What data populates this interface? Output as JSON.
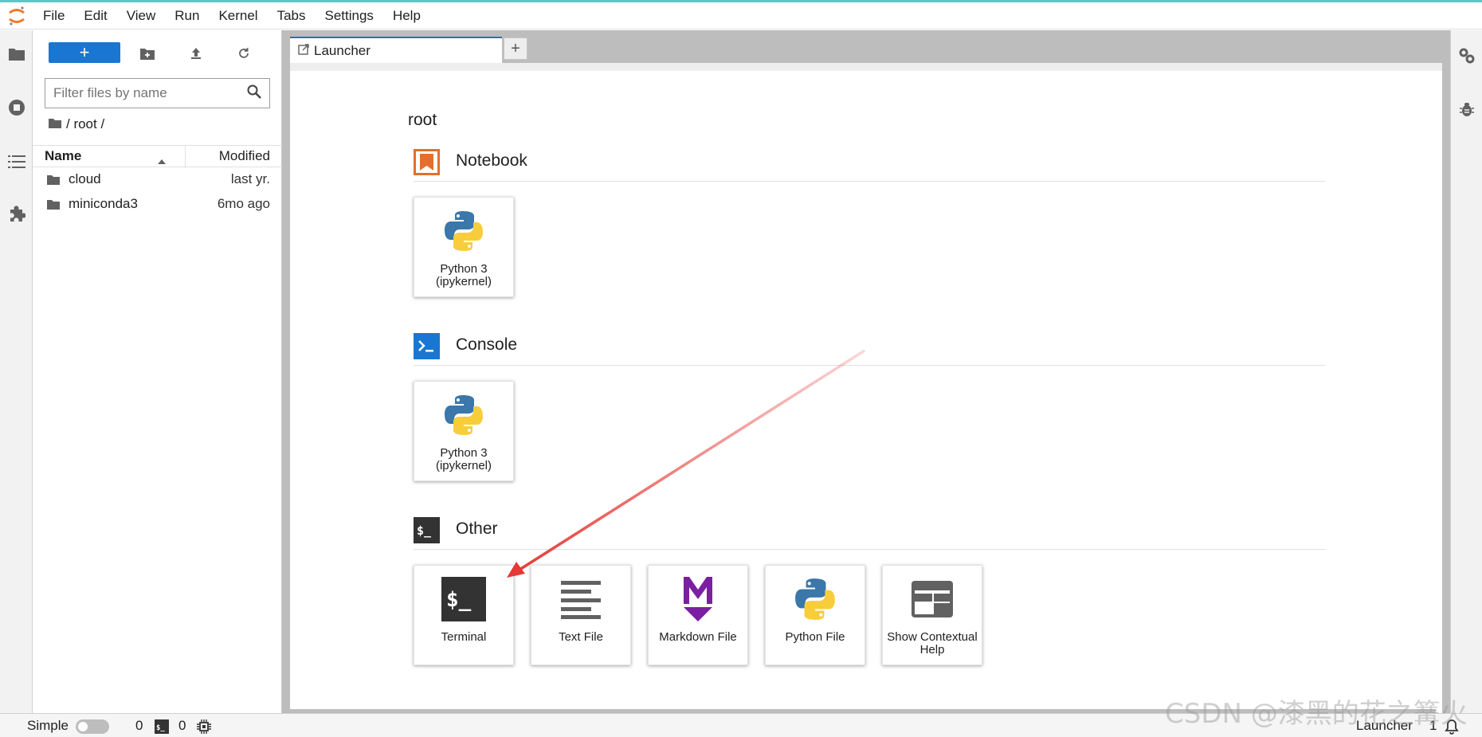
{
  "menubar": {
    "items": [
      "File",
      "Edit",
      "View",
      "Run",
      "Kernel",
      "Tabs",
      "Settings",
      "Help"
    ]
  },
  "filebrowser": {
    "new_label": "+",
    "filter_placeholder": "Filter files by name",
    "breadcrumb": "/ root /",
    "col_name": "Name",
    "col_modified": "Modified",
    "files": [
      {
        "name": "cloud",
        "modified": "last yr."
      },
      {
        "name": "miniconda3",
        "modified": "6mo ago"
      }
    ]
  },
  "tabs": {
    "active": "Launcher",
    "add": "+"
  },
  "launcher": {
    "root": "root",
    "sections": {
      "notebook": {
        "title": "Notebook",
        "cards": [
          {
            "label": "Python 3 (ipykernel)"
          }
        ]
      },
      "console": {
        "title": "Console",
        "cards": [
          {
            "label": "Python 3 (ipykernel)"
          }
        ]
      },
      "other": {
        "title": "Other",
        "cards": [
          {
            "label": "Terminal"
          },
          {
            "label": "Text File"
          },
          {
            "label": "Markdown File"
          },
          {
            "label": "Python File"
          },
          {
            "label": "Show Contextual Help"
          }
        ]
      }
    }
  },
  "statusbar": {
    "mode": "Simple",
    "terminals": "0",
    "kernels": "0",
    "current": "Launcher",
    "notifications": "1"
  },
  "watermark": "CSDN @漆黑的花之篝火",
  "colors": {
    "accent": "#1976d2",
    "notebook": "#e46e2e",
    "console": "#1976d2",
    "arrow": "#e53935"
  }
}
